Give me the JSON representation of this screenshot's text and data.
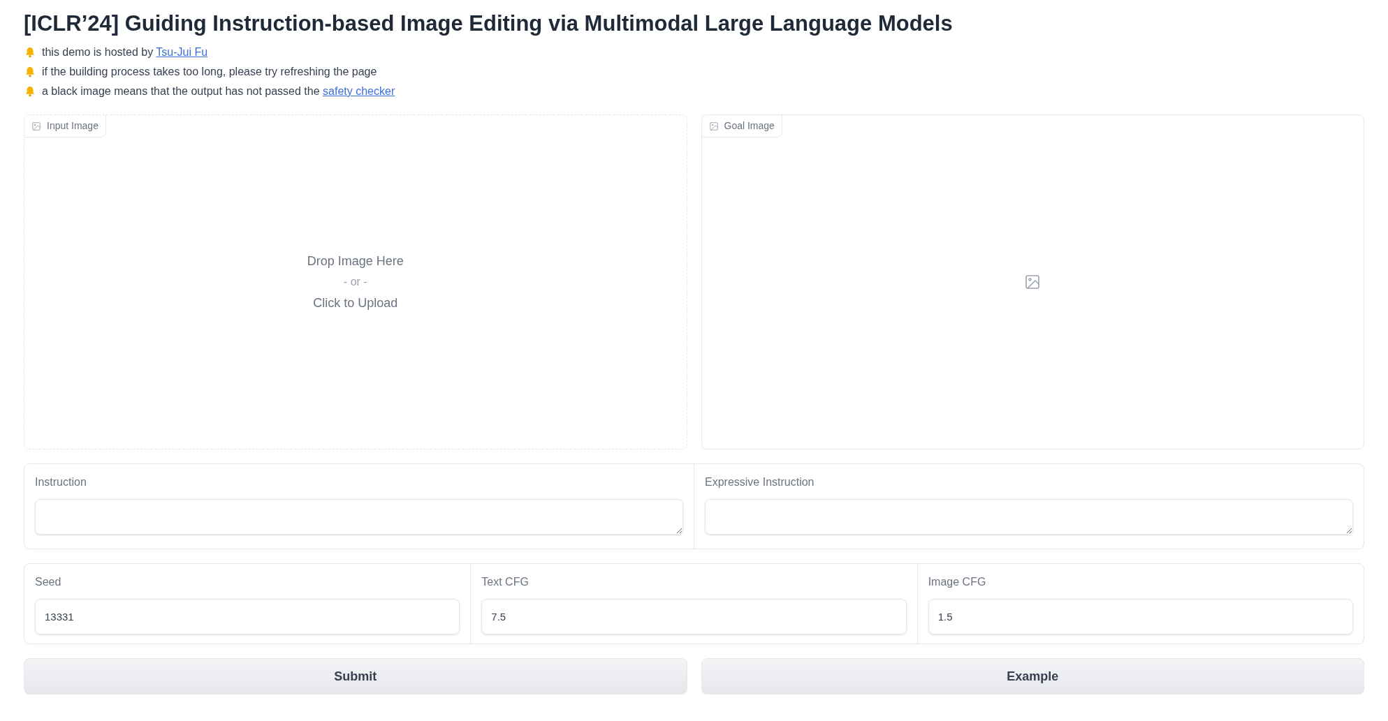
{
  "title": "[ICLR’24] Guiding Instruction-based Image Editing via Multimodal Large Language Models",
  "notes": [
    {
      "text": "this demo is hosted by ",
      "link": "Tsu-Jui Fu"
    },
    {
      "text": "if the building process takes too long, please try refreshing the page"
    },
    {
      "text": "a black image means that the output has not passed the ",
      "link": "safety checker"
    }
  ],
  "images": [
    {
      "label": "Input Image",
      "kind": "upload",
      "prompt": [
        "Drop Image Here",
        "- or -",
        "Click to Upload"
      ]
    },
    {
      "label": "Goal Image",
      "kind": "output"
    }
  ],
  "text_fields": [
    {
      "label": "Instruction"
    },
    {
      "label": "Expressive Instruction"
    }
  ],
  "number_fields": [
    {
      "label": "Seed",
      "value": "13331"
    },
    {
      "label": "Text CFG",
      "value": "7.5"
    },
    {
      "label": "Image CFG",
      "value": "1.5"
    }
  ],
  "buttons": [
    "Submit",
    "Example"
  ]
}
